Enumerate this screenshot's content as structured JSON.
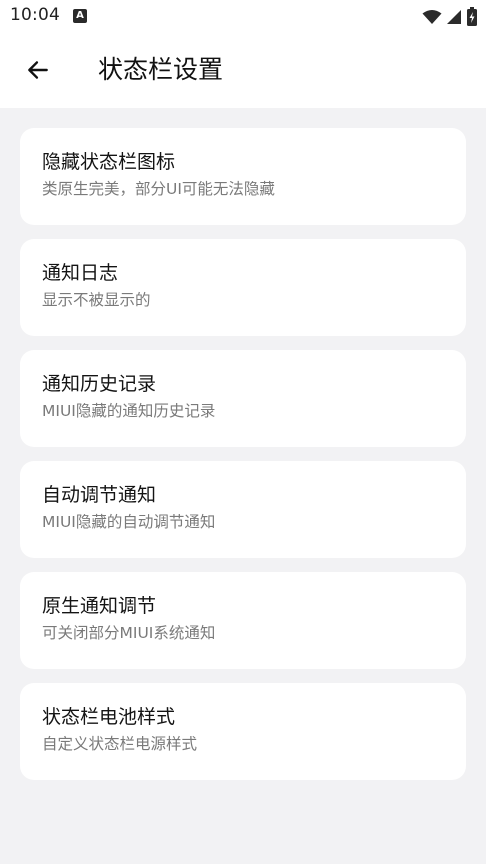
{
  "status_bar": {
    "time": "10:04",
    "notification_icon": "A"
  },
  "app_bar": {
    "title": "状态栏设置"
  },
  "settings": [
    {
      "title": "隐藏状态栏图标",
      "subtitle": "类原生完美，部分UI可能无法隐藏"
    },
    {
      "title": "通知日志",
      "subtitle": "显示不被显示的"
    },
    {
      "title": "通知历史记录",
      "subtitle": "MIUI隐藏的通知历史记录"
    },
    {
      "title": "自动调节通知",
      "subtitle": "MIUI隐藏的自动调节通知"
    },
    {
      "title": "原生通知调节",
      "subtitle": "可关闭部分MIUI系统通知"
    },
    {
      "title": "状态栏电池样式",
      "subtitle": "自定义状态栏电源样式"
    }
  ],
  "icons": {
    "back": "arrow-left-icon",
    "wifi": "wifi-icon",
    "signal": "cell-signal-icon",
    "battery": "battery-charging-icon"
  },
  "colors": {
    "background": "#f2f2f4",
    "card": "#ffffff",
    "title_text": "#141414",
    "subtitle_text": "#7a7a7a"
  }
}
